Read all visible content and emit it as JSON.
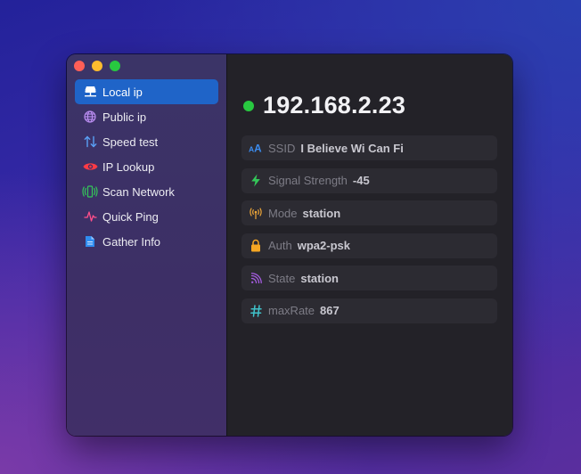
{
  "colors": {
    "accent": "#1f64c8",
    "status_online": "#28c840",
    "close": "#ff5f57",
    "minimize": "#febc2e",
    "maximize": "#28c840"
  },
  "sidebar": {
    "items": [
      {
        "label": "Local ip",
        "icon": "network-server-icon",
        "active": true
      },
      {
        "label": "Public ip",
        "icon": "globe-icon",
        "active": false
      },
      {
        "label": "Speed test",
        "icon": "up-down-arrows-icon",
        "active": false
      },
      {
        "label": "IP Lookup",
        "icon": "eye-icon",
        "active": false
      },
      {
        "label": "Scan Network",
        "icon": "phone-radiowaves-icon",
        "active": false
      },
      {
        "label": "Quick Ping",
        "icon": "waveform-icon",
        "active": false
      },
      {
        "label": "Gather Info",
        "icon": "document-icon",
        "active": false
      }
    ]
  },
  "main": {
    "ip": "192.168.2.23",
    "info": [
      {
        "key": "SSID",
        "value": "I Believe Wi Can Fi",
        "icon": "text-size-icon",
        "color": "#3b8df2"
      },
      {
        "key": "Signal Strength",
        "value": "-45",
        "icon": "bolt-icon",
        "color": "#34c759"
      },
      {
        "key": "Mode",
        "value": "station",
        "icon": "antenna-icon",
        "color": "#f2a838"
      },
      {
        "key": "Auth",
        "value": "wpa2-psk",
        "icon": "lock-icon",
        "color": "#f5a623"
      },
      {
        "key": "State",
        "value": "station",
        "icon": "signal-arcs-icon",
        "color": "#a45ce0"
      },
      {
        "key": "maxRate",
        "value": "867",
        "icon": "hash-icon",
        "color": "#3fc1c9"
      }
    ]
  }
}
